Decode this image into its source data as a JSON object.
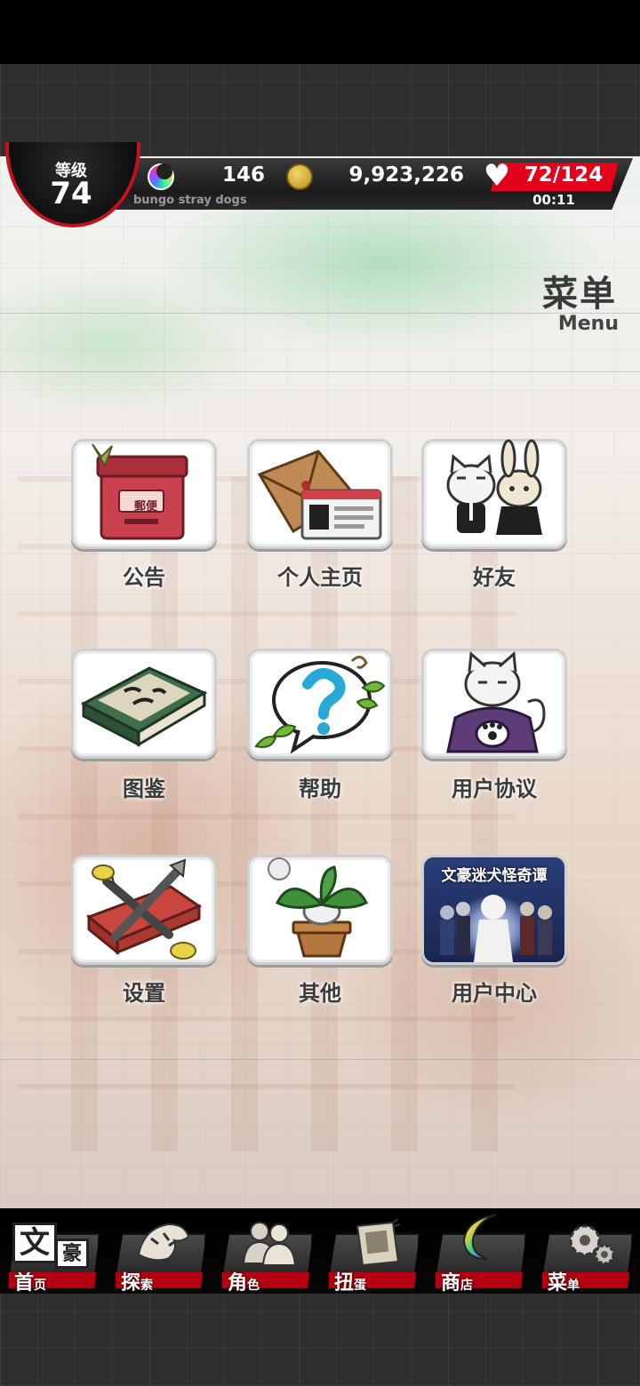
{
  "hud": {
    "level_label": "等级",
    "level_value": "74",
    "gem_count": "146",
    "coin_count": "9,923,226",
    "ap_value": "72/124",
    "ap_timer": "00:11",
    "subtitle": "bungo stray dogs",
    "accent_red": "#e2001a"
  },
  "page": {
    "title": "菜单",
    "subtitle": "Menu"
  },
  "menu": {
    "items": [
      {
        "label": "公告",
        "icon": "mailbox-icon"
      },
      {
        "label": "个人主页",
        "icon": "profile-card-icon"
      },
      {
        "label": "好友",
        "icon": "friends-plush-icon"
      },
      {
        "label": "图鉴",
        "icon": "book-icon"
      },
      {
        "label": "帮助",
        "icon": "help-bubble-icon"
      },
      {
        "label": "用户协议",
        "icon": "cat-telephone-icon"
      },
      {
        "label": "设置",
        "icon": "tools-icon"
      },
      {
        "label": "其他",
        "icon": "plant-icon"
      },
      {
        "label": "用户中心",
        "icon": "user-center-banner-icon"
      }
    ],
    "banner_text": "文豪迷犬怪奇谭",
    "mailbox_text": "郵便"
  },
  "dock": {
    "home": {
      "label": "首",
      "small": "页"
    },
    "explore": {
      "label": "探",
      "small": "索"
    },
    "characters": {
      "label": "角",
      "small": "色"
    },
    "gacha": {
      "label": "扭",
      "small": "蛋"
    },
    "shop": {
      "label": "商",
      "small": "店"
    },
    "menu": {
      "label": "菜",
      "small": "单"
    },
    "home_logo_a": "文",
    "home_logo_b": "豪"
  }
}
